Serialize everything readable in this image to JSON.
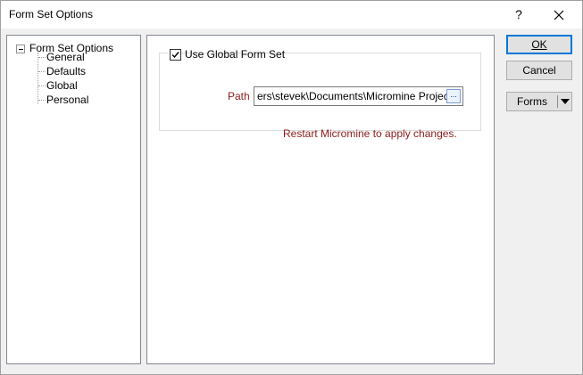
{
  "window": {
    "title": "Form Set Options",
    "help_glyph": "?",
    "close_glyph": "✕"
  },
  "tree": {
    "root_label": "Form Set Options",
    "items": [
      {
        "label": "General"
      },
      {
        "label": "Defaults"
      },
      {
        "label": "Global"
      },
      {
        "label": "Personal"
      }
    ]
  },
  "global_panel": {
    "checkbox_label": "Use Global Form Set",
    "checkbox_checked": true,
    "path_label": "Path",
    "path_value": "ers\\stevek\\Documents\\Micromine Projects",
    "browse_glyph": "...",
    "restart_message": "Restart Micromine to apply changes."
  },
  "buttons": {
    "ok_label": "OK",
    "cancel_label": "Cancel",
    "forms_label": "Forms"
  },
  "colors": {
    "label_red": "#8b1a1a",
    "default_button_border": "#0078d7"
  },
  "icons": {
    "expander": "collapse-minus-icon",
    "browse": "ellipsis-icon",
    "dropdown": "chevron-down-icon"
  }
}
